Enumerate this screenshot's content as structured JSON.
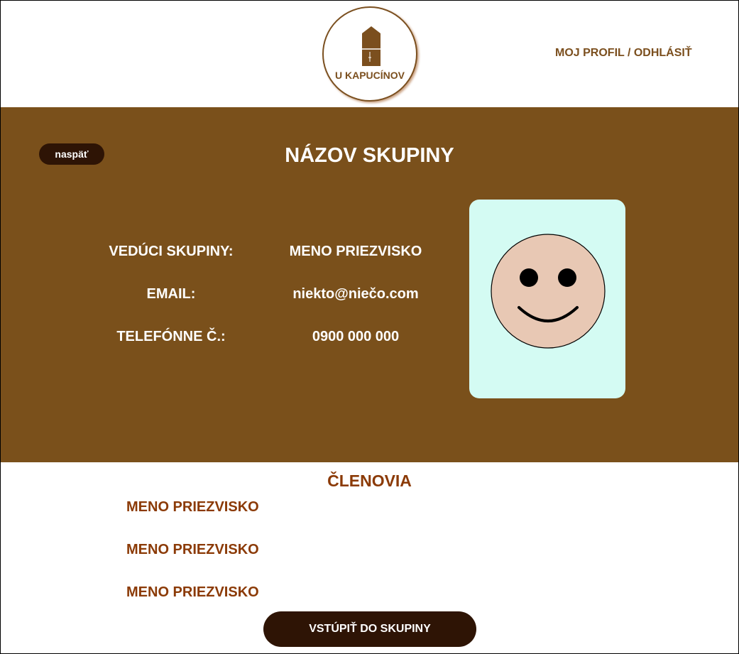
{
  "header": {
    "logo_text": "U KAPUCÍNOV",
    "profile_link": "MOJ PROFIL / ODHLÁSIŤ"
  },
  "group": {
    "back_label": "naspäť",
    "title": "NÁZOV SKUPINY",
    "fields": [
      {
        "label": "VEDÚCI SKUPINY:",
        "value": "MENO PRIEZVISKO"
      },
      {
        "label": "EMAIL:",
        "value": "niekto@niečo.com"
      },
      {
        "label": "TELEFÓNNE Č.:",
        "value": "0900 000 000"
      }
    ],
    "photo_icon": "smiley-face-icon"
  },
  "members": {
    "title": "ČLENOVIA",
    "list": [
      "MENO PRIEZVISKO",
      "MENO PRIEZVISKO",
      "MENO PRIEZVISKO"
    ]
  },
  "join_label": "VSTÚPIŤ DO SKUPINY",
  "colors": {
    "panel": "#7a501b",
    "dark_button": "#2e1405",
    "accent_text": "#8b3a06",
    "photo_bg": "#d4fbf3",
    "face": "#e8c8b4"
  }
}
